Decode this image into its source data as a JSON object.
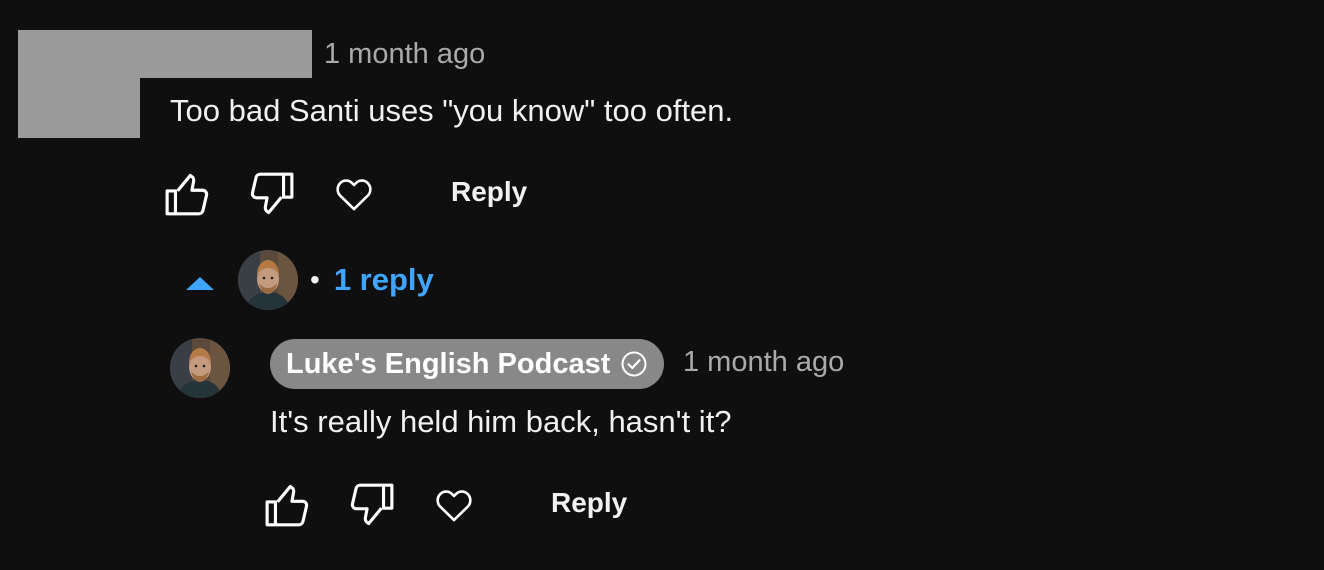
{
  "comment": {
    "timestamp": "1 month ago",
    "text": "Too bad Santi uses \"you know\" too often.",
    "actions": {
      "like_icon": "thumbs-up-icon",
      "dislike_icon": "thumbs-down-icon",
      "heart_icon": "heart-icon",
      "reply_label": "Reply"
    }
  },
  "replies_toggle": {
    "bullet": "•",
    "label": "1 reply",
    "icon": "caret-up-icon"
  },
  "reply": {
    "author": "Luke's English Podcast",
    "verified_icon": "verified-check-icon",
    "timestamp": "1 month ago",
    "text": "It's really held him back, hasn't it?",
    "actions": {
      "like_icon": "thumbs-up-icon",
      "dislike_icon": "thumbs-down-icon",
      "heart_icon": "heart-icon",
      "reply_label": "Reply"
    }
  },
  "colors": {
    "background": "#0f0f0f",
    "link_blue": "#3ea6ff",
    "muted_text": "#aaaaaa",
    "author_chip": "#888888",
    "redaction": "#9a9a9a"
  }
}
